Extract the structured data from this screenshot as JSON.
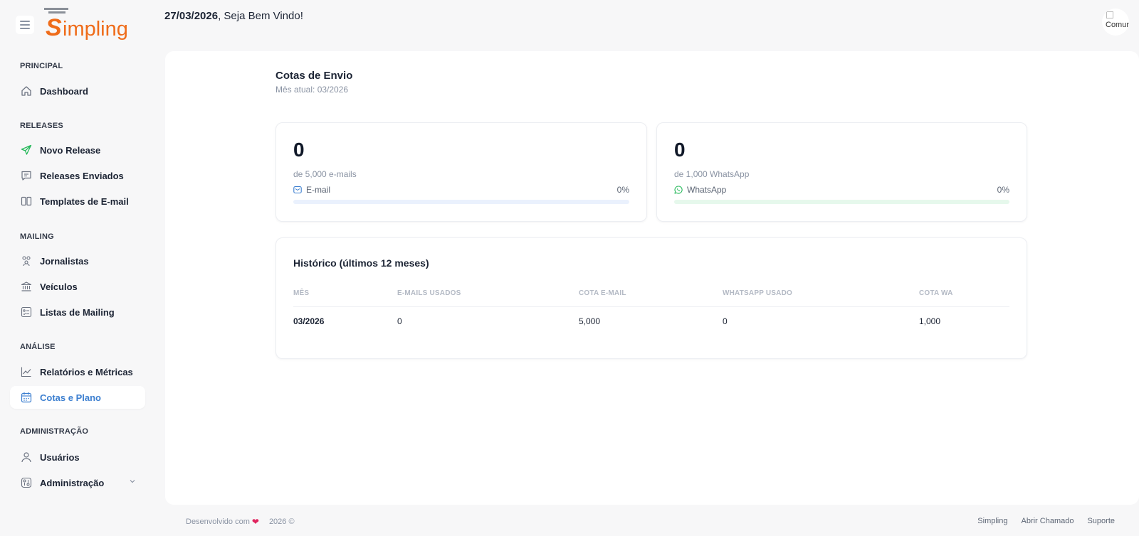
{
  "brand": {
    "logo_text": "Simpling",
    "accent": "#ef6c1a"
  },
  "header": {
    "date": "27/03/2026",
    "greeting": ", Seja Bem Vindo!",
    "avatar_alt": "Comur"
  },
  "sidebar": {
    "sections": [
      {
        "title": "PRINCIPAL",
        "items": [
          {
            "label": "Dashboard",
            "icon": "home-icon"
          }
        ]
      },
      {
        "title": "RELEASES",
        "items": [
          {
            "label": "Novo Release",
            "icon": "send-icon"
          },
          {
            "label": "Releases Enviados",
            "icon": "message-icon"
          },
          {
            "label": "Templates de E-mail",
            "icon": "columns-icon"
          }
        ]
      },
      {
        "title": "MAILING",
        "items": [
          {
            "label": "Jornalistas",
            "icon": "users-icon"
          },
          {
            "label": "Veículos",
            "icon": "bank-icon"
          },
          {
            "label": "Listas de Mailing",
            "icon": "list-icon"
          }
        ]
      },
      {
        "title": "ANÁLISE",
        "items": [
          {
            "label": "Relatórios e Métricas",
            "icon": "chart-icon"
          },
          {
            "label": "Cotas e Plano",
            "icon": "calendar-icon",
            "active": true
          }
        ]
      },
      {
        "title": "ADMINISTRAÇÃO",
        "items": [
          {
            "label": "Usuários",
            "icon": "user-icon"
          },
          {
            "label": "Administração",
            "icon": "settings-icon"
          }
        ]
      }
    ]
  },
  "page": {
    "title": "Cotas de Envio",
    "subtitle": "Mês atual: 03/2026"
  },
  "quotas": {
    "email": {
      "value": "0",
      "caption": "de 5,000 e-mails",
      "label": "E-mail",
      "percent_text": "0%",
      "fill_percent": 0,
      "track_color": "#eaf1fd",
      "fill_color": "#3c7fd0"
    },
    "whatsapp": {
      "value": "0",
      "caption": "de 1,000 WhatsApp",
      "label": "WhatsApp",
      "percent_text": "0%",
      "fill_percent": 0,
      "track_color": "#e6f8ec",
      "fill_color": "#25b85a"
    }
  },
  "history": {
    "title": "Histórico (últimos 12 meses)",
    "columns": [
      "MÊS",
      "E-MAILS USADOS",
      "COTA E-MAIL",
      "WHATSAPP USADO",
      "COTA WA"
    ],
    "rows": [
      [
        "03/2026",
        "0",
        "5,000",
        "0",
        "1,000"
      ]
    ]
  },
  "footer": {
    "developed_with": "Desenvolvido com",
    "year": "2026 ©",
    "links": [
      "Simpling",
      "Abrir Chamado",
      "Suporte"
    ]
  }
}
